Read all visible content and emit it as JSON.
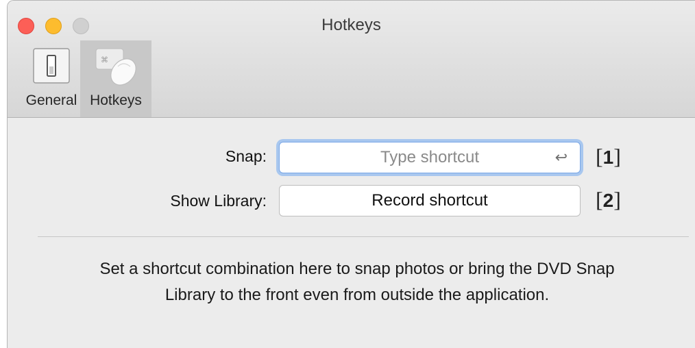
{
  "window": {
    "title": "Hotkeys"
  },
  "toolbar": {
    "tabs": [
      {
        "label": "General",
        "icon": "switch-icon",
        "selected": false
      },
      {
        "label": "Hotkeys",
        "icon": "keyboard-mouse-icon",
        "selected": true
      }
    ]
  },
  "hotkeys": {
    "snap": {
      "label": "Snap:",
      "placeholder": "Type shortcut",
      "return_glyph": "↩",
      "annotation_open": "[",
      "annotation_num": "1",
      "annotation_close": "]"
    },
    "show_library": {
      "label": "Show Library:",
      "button_text": "Record shortcut",
      "annotation_open": "[",
      "annotation_num": "2",
      "annotation_close": "]"
    }
  },
  "description": {
    "line1": "Set a shortcut combination here to snap photos or bring the DVD Snap",
    "line2": "Library to the front even from outside the application."
  },
  "colors": {
    "close": "#fc5f57",
    "minimize": "#fdbc2e",
    "zoom_disabled": "#d0d0d0",
    "focus_ring": "#a8c7ef"
  }
}
